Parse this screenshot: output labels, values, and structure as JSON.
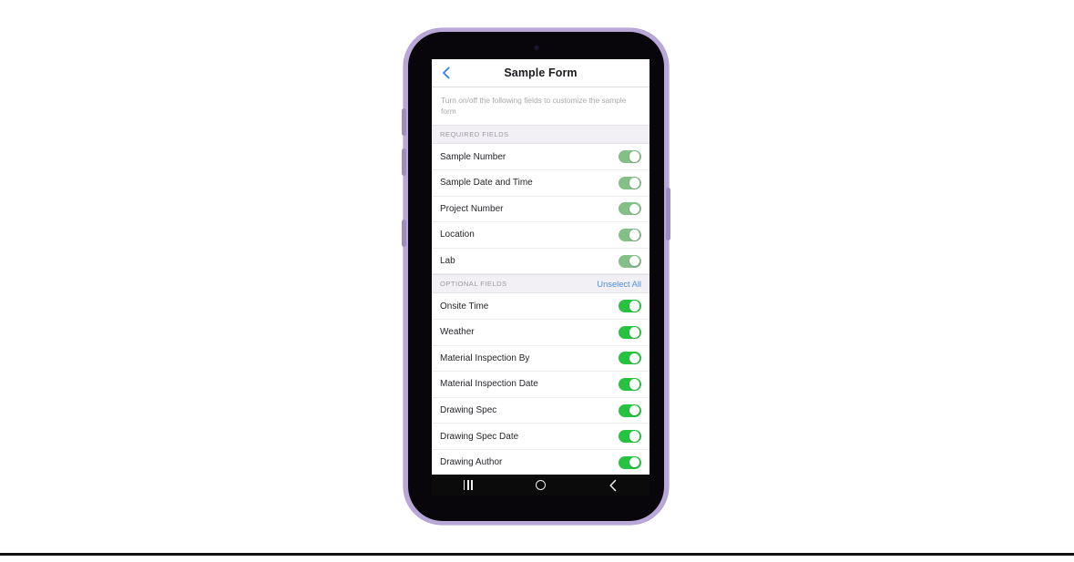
{
  "device": {
    "frame_color": "#b9a7d8",
    "bezel_color": "#08060a",
    "camera_icon": "punch-hole-camera"
  },
  "screen": {
    "header": {
      "back_icon": "chevron-left-icon",
      "title": "Sample Form",
      "title_color": "#1b1b1f",
      "accent_color": "#4a90e2"
    },
    "description": "Turn on/off the following fields to customize the sample form",
    "sections": [
      {
        "id": "required",
        "title": "REQUIRED FIELDS",
        "action_label": null,
        "toggle_style": "on-muted",
        "rows": [
          {
            "label": "Sample Number",
            "state": "on"
          },
          {
            "label": "Sample Date and Time",
            "state": "on"
          },
          {
            "label": "Project Number",
            "state": "on"
          },
          {
            "label": "Location",
            "state": "on"
          },
          {
            "label": "Lab",
            "state": "on"
          }
        ]
      },
      {
        "id": "optional",
        "title": "OPTIONAL FIELDS",
        "action_label": "Unselect All",
        "toggle_style": "on-strong",
        "rows": [
          {
            "label": "Onsite Time",
            "state": "on"
          },
          {
            "label": "Weather",
            "state": "on"
          },
          {
            "label": "Material Inspection By",
            "state": "on"
          },
          {
            "label": "Material Inspection Date",
            "state": "on"
          },
          {
            "label": "Drawing Spec",
            "state": "on"
          },
          {
            "label": "Drawing Spec Date",
            "state": "on"
          },
          {
            "label": "Drawing Author",
            "state": "on"
          }
        ]
      }
    ],
    "nav_bar": {
      "recents_icon": "recents-icon",
      "home_icon": "home-icon",
      "back_icon": "back-icon"
    }
  },
  "colors": {
    "toggle_on_strong": "#27c340",
    "toggle_on_muted": "#83bf87",
    "section_bg": "#f2f0f5",
    "link_blue": "#4a90e2"
  }
}
